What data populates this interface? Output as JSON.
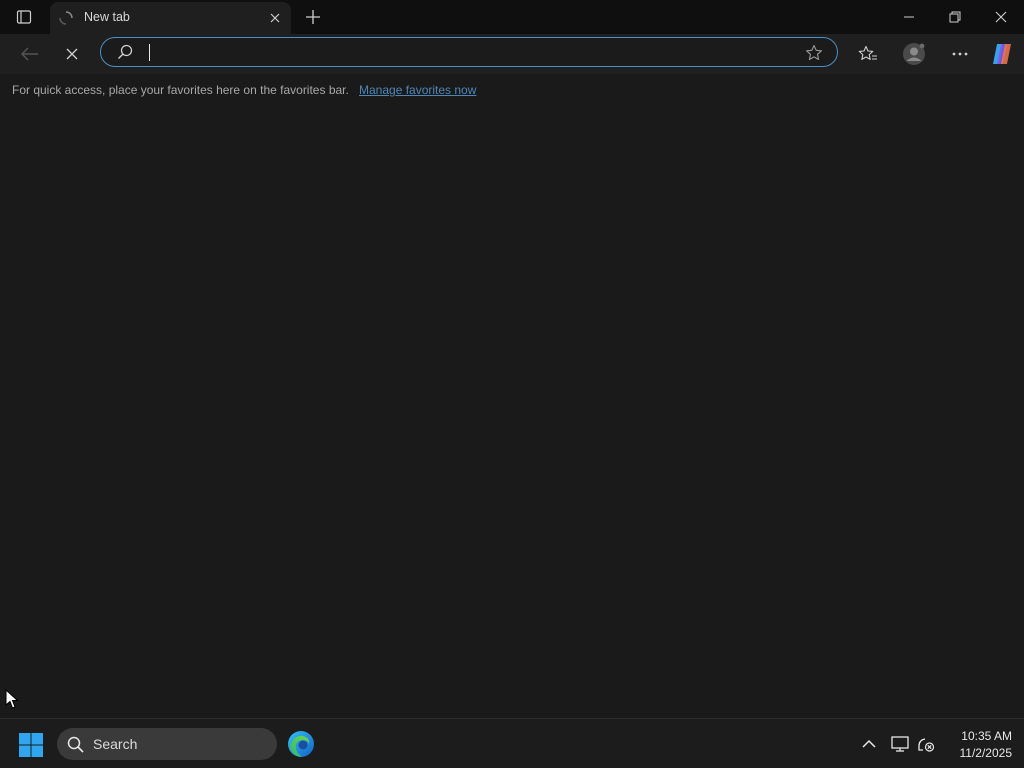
{
  "browser": {
    "tab": {
      "title": "New tab"
    },
    "omnibox": {
      "value": "",
      "placeholder": ""
    },
    "favorites_bar": {
      "message": "For quick access, place your favorites here on the favorites bar.",
      "link": "Manage favorites now"
    }
  },
  "taskbar": {
    "search_label": "Search",
    "clock": {
      "time": "10:35 AM",
      "date": "11/2/2025"
    }
  },
  "colors": {
    "accent": "#4a90c8",
    "link": "#4f86b8",
    "background": "#1a1a1a",
    "titlebar": "#0f0f0f"
  },
  "icons": [
    "tab-actions-icon",
    "loading-spinner-icon",
    "close-icon",
    "plus-icon",
    "minimize-icon",
    "restore-icon",
    "back-icon",
    "stop-icon",
    "search-icon",
    "star-icon",
    "favorites-icon",
    "profile-icon",
    "more-icon",
    "copilot-icon",
    "windows-logo-icon",
    "edge-icon",
    "chevron-up-icon",
    "display-icon",
    "network-disconnected-icon"
  ]
}
